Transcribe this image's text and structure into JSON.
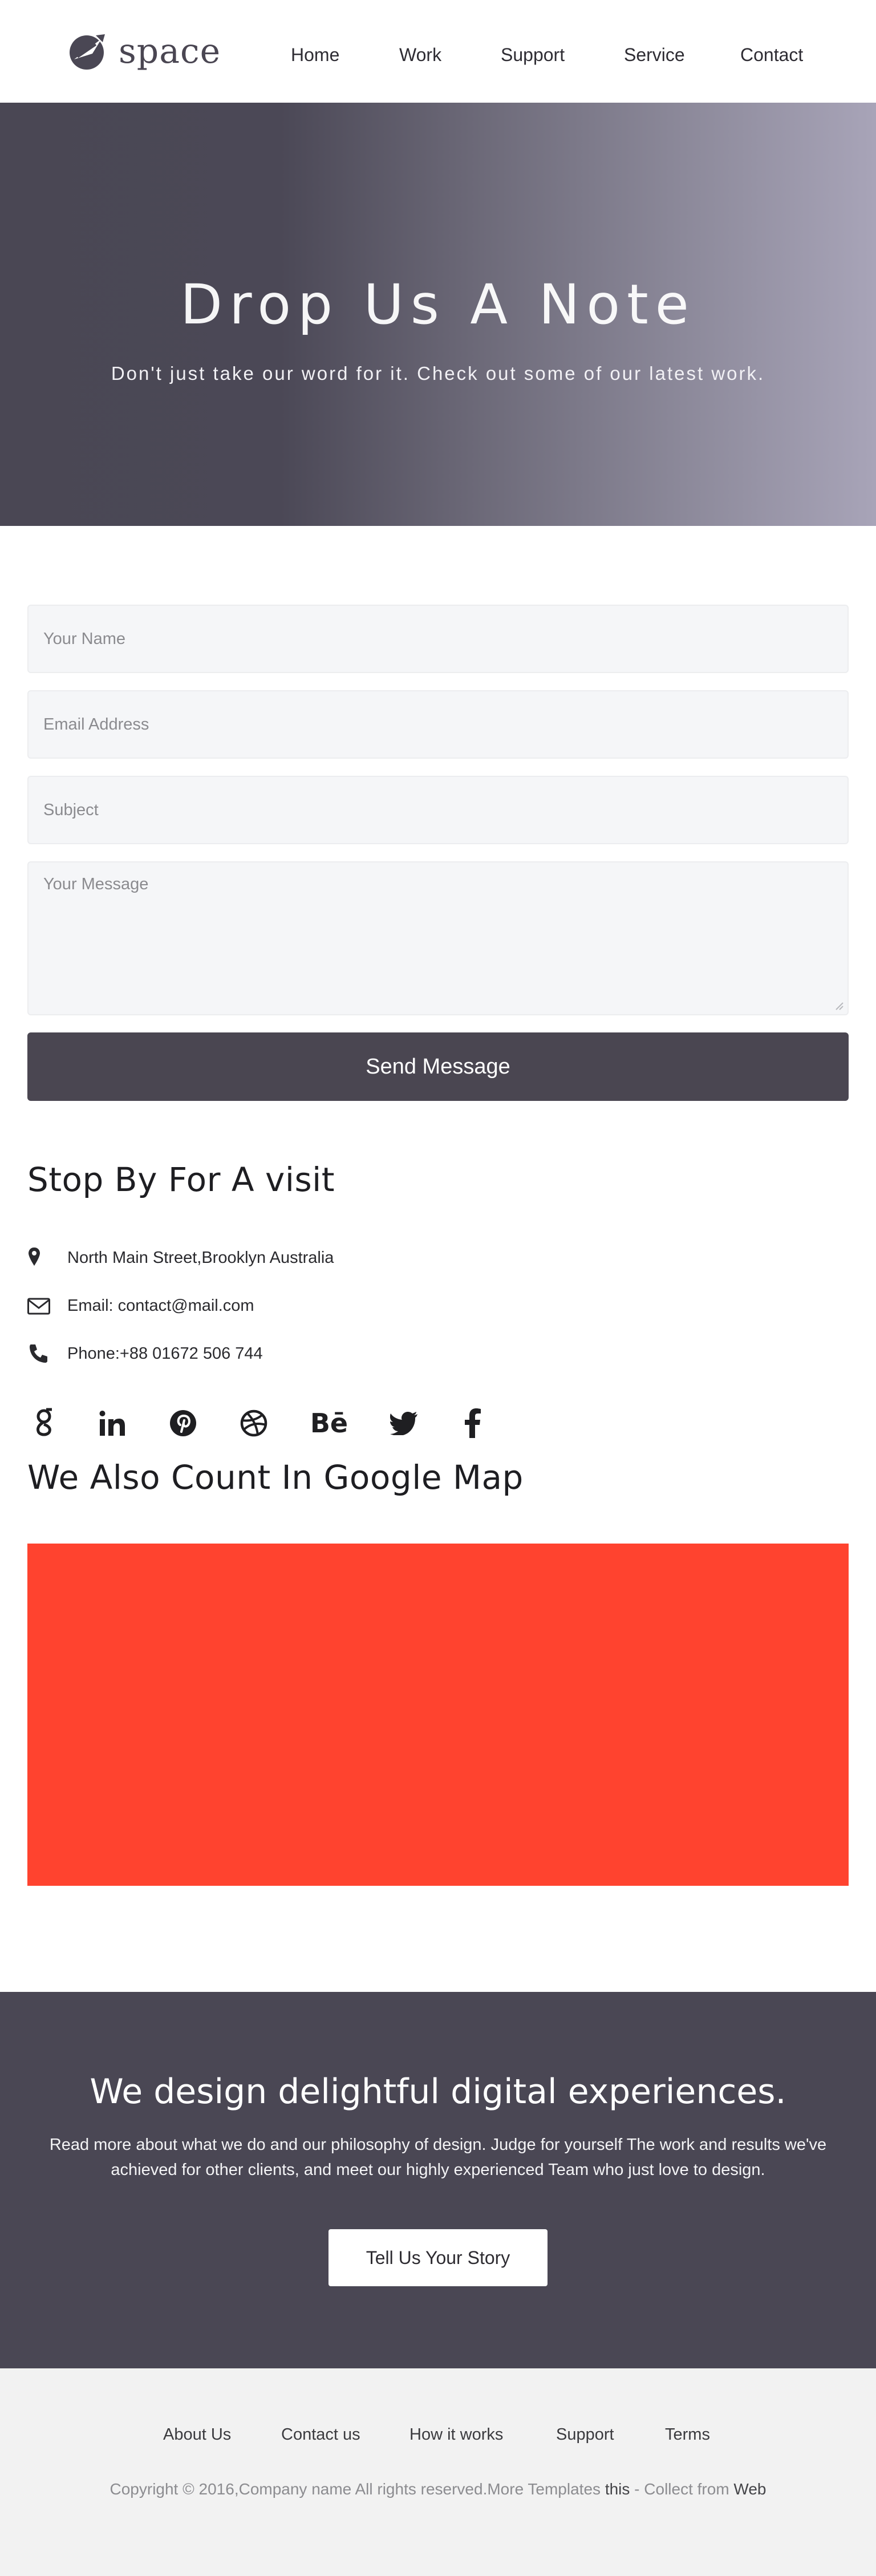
{
  "header": {
    "logo_text": "space",
    "nav": [
      "Home",
      "Work",
      "Support",
      "Service",
      "Contact"
    ]
  },
  "hero": {
    "title": "Drop Us A Note",
    "subtitle": "Don't just take our word for it. Check out some of our latest work."
  },
  "form": {
    "name_placeholder": "Your Name",
    "email_placeholder": "Email Address",
    "subject_placeholder": "Subject",
    "message_placeholder": "Your Message",
    "send_label": "Send Message"
  },
  "visit": {
    "title": "Stop By For A visit",
    "address": "North Main Street,Brooklyn Australia",
    "email": "Email: contact@mail.com",
    "phone": "Phone:+88 01672 506 744"
  },
  "social": [
    "google-plus-icon",
    "linkedin-icon",
    "pinterest-icon",
    "dribbble-icon",
    "behance-icon",
    "twitter-icon",
    "facebook-icon"
  ],
  "map_section": {
    "title": "We Also Count In Google Map",
    "map_color": "#ff432f"
  },
  "cta": {
    "title": "We design delightful digital experiences.",
    "text": "Read more about what we do and our philosophy of design. Judge for yourself The work and results we've achieved for other clients, and meet our highly experienced Team who just love to design.",
    "button_label": "Tell Us Your Story"
  },
  "footer": {
    "links": [
      "About Us",
      "Contact us",
      "How it works",
      "Support",
      "Terms"
    ],
    "copyright_main": "Copyright © 2016,Company name All rights reserved.More Templates ",
    "copyright_link1": "this",
    "copyright_mid": " - Collect from ",
    "copyright_link2": "Web"
  },
  "colors": {
    "dark": "#4a4754",
    "accent_map": "#ff432f",
    "footer_bg": "#f2f2f2"
  }
}
